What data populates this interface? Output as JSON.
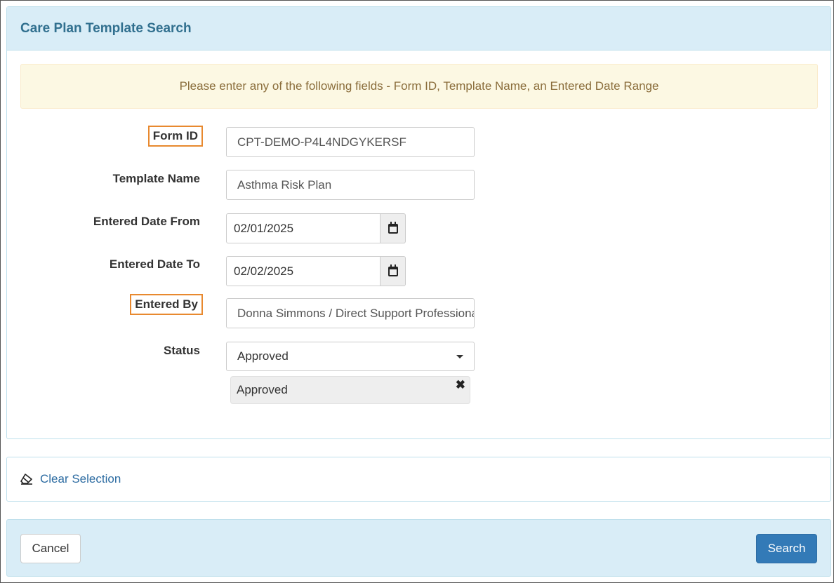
{
  "panel": {
    "title": "Care Plan Template Search",
    "alert": "Please enter any of the following fields - Form ID, Template Name, an Entered Date Range"
  },
  "form": {
    "form_id": {
      "label": "Form ID",
      "value": "CPT-DEMO-P4L4NDGYKERSF"
    },
    "template_name": {
      "label": "Template Name",
      "value": "Asthma Risk Plan"
    },
    "date_from": {
      "label": "Entered Date From",
      "value": "02/01/2025"
    },
    "date_to": {
      "label": "Entered Date To",
      "value": "02/02/2025"
    },
    "entered_by": {
      "label": "Entered By",
      "value": "Donna Simmons / Direct Support Professional"
    },
    "status": {
      "label": "Status",
      "selected": "Approved",
      "chip": "Approved"
    }
  },
  "actions": {
    "clear_selection": "Clear Selection",
    "cancel": "Cancel",
    "search": "Search"
  },
  "icons": {
    "calendar": "calendar-icon",
    "eraser": "eraser-icon",
    "remove": "close-icon",
    "dropdown": "caret-down-icon"
  },
  "colors": {
    "highlight": "#e8892f",
    "primary": "#337ab7",
    "heading_bg": "#d9edf7",
    "alert_bg": "#fcf8e3"
  }
}
